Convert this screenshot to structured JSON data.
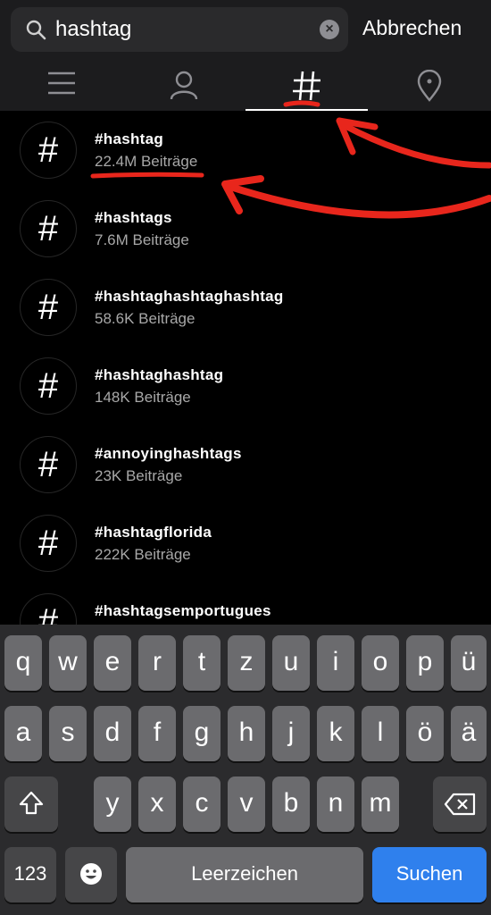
{
  "search": {
    "value": "hashtag",
    "cancel_label": "Abbrechen"
  },
  "tabs": [
    {
      "name": "tab-top",
      "icon": "menu-icon",
      "active": false
    },
    {
      "name": "tab-accounts",
      "icon": "person-icon",
      "active": false
    },
    {
      "name": "tab-tags",
      "icon": "hashtag-icon",
      "active": true
    },
    {
      "name": "tab-places",
      "icon": "location-pin-icon",
      "active": false
    }
  ],
  "results": [
    {
      "symbol": "#",
      "name": "#hashtag",
      "count": "22.4M Beiträge"
    },
    {
      "symbol": "#",
      "name": "#hashtags",
      "count": "7.6M Beiträge"
    },
    {
      "symbol": "#",
      "name": "#hashtaghashtaghashtag",
      "count": "58.6K Beiträge"
    },
    {
      "symbol": "#",
      "name": "#hashtaghashtag",
      "count": "148K Beiträge"
    },
    {
      "symbol": "#",
      "name": "#annoyinghashtags",
      "count": "23K Beiträge"
    },
    {
      "symbol": "#",
      "name": "#hashtagflorida",
      "count": "222K Beiträge"
    },
    {
      "symbol": "#",
      "name": "#hashtagsemportugues",
      "count": ""
    }
  ],
  "keyboard": {
    "row1": [
      "q",
      "w",
      "e",
      "r",
      "t",
      "z",
      "u",
      "i",
      "o",
      "p",
      "ü"
    ],
    "row2": [
      "a",
      "s",
      "d",
      "f",
      "g",
      "h",
      "j",
      "k",
      "l",
      "ö",
      "ä"
    ],
    "row3": [
      "y",
      "x",
      "c",
      "v",
      "b",
      "n",
      "m"
    ],
    "numbers_label": "123",
    "space_label": "Leerzeichen",
    "search_label": "Suchen"
  },
  "colors": {
    "annotation": "#e8261c",
    "search_key": "#2f80ed",
    "background": "#000000"
  }
}
